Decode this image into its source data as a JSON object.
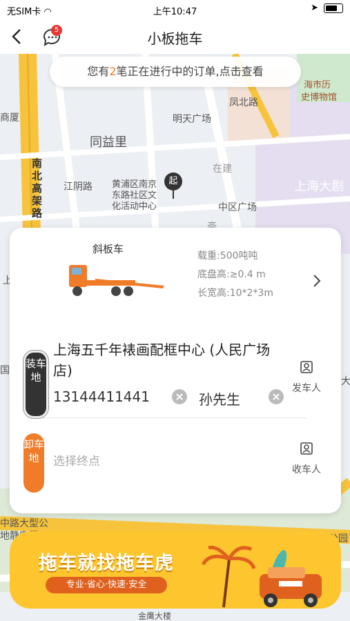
{
  "status_bar": {
    "carrier": "无SIM卡",
    "time": "上午10:47"
  },
  "nav": {
    "title": "小板拖车",
    "message_badge": "5"
  },
  "order_banner": {
    "prefix": "您有",
    "count": "2",
    "suffix": "笔正在进行中的订单,点击查看"
  },
  "map": {
    "labels": [
      "同益里",
      "明天广场",
      "黄浦区南京",
      "东路社区文",
      "化活动中心",
      "江阴路",
      "中区广场",
      "在建",
      "上海大剧",
      "南北高架路",
      "商厦",
      "海市历",
      "史博物馆",
      "凤北路",
      "中路大型公",
      "地静安区",
      "公园",
      "国",
      "上",
      "大",
      "斋",
      "金鹰大楼"
    ],
    "start_pin": "起"
  },
  "vehicle": {
    "name": "斜板车",
    "load": "载重:500吨吨",
    "chassis": "底盘高:≥0.4 m",
    "size": "长宽高:10*2*3m"
  },
  "pickup": {
    "tag": "装车地",
    "address": "上海五千年裱画配框中心 (人民广场店)",
    "phone": "13144411441",
    "contact": "孙先生",
    "person_label": "发车人"
  },
  "dropoff": {
    "tag": "卸车地",
    "placeholder": "选择终点",
    "person_label": "收车人"
  },
  "promo": {
    "title": "拖车就找拖车虎",
    "subtitle": "专业·省心·快速·安全"
  },
  "colors": {
    "accent": "#f07c2a",
    "promo_bg": "#fdc62f",
    "dark_tag": "#333333"
  }
}
